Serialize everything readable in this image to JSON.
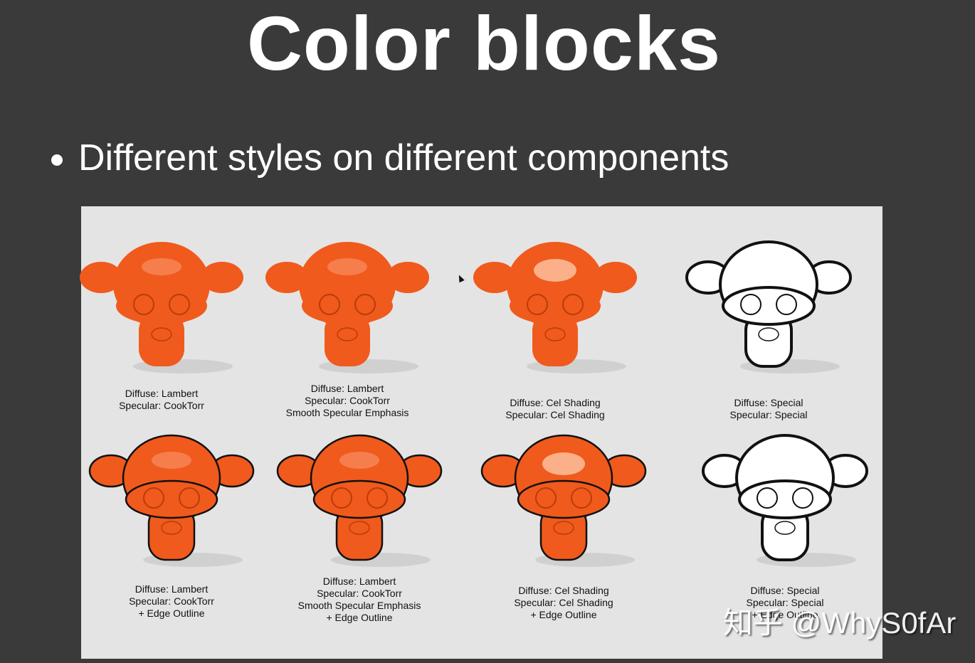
{
  "slide": {
    "title": "Color blocks",
    "bullet": "Different styles on different components"
  },
  "figure": {
    "colors": {
      "orange": "#f05a1c",
      "background": "#e4e4e4",
      "outline": "#111111",
      "white": "#ffffff"
    },
    "cells": [
      {
        "style": "orange",
        "outline": false,
        "caption": [
          "Diffuse: Lambert",
          "Specular: CookTorr"
        ]
      },
      {
        "style": "orange",
        "outline": false,
        "caption": [
          "Diffuse: Lambert",
          "Specular: CookTorr",
          "Smooth Specular Emphasis"
        ]
      },
      {
        "style": "orange-cel",
        "outline": false,
        "caption": [
          "Diffuse: Cel Shading",
          "Specular: Cel Shading"
        ]
      },
      {
        "style": "white",
        "outline": true,
        "caption": [
          "Diffuse: Special",
          "Specular: Special"
        ]
      },
      {
        "style": "orange",
        "outline": true,
        "caption": [
          "Diffuse: Lambert",
          "Specular: CookTorr",
          "+ Edge Outline"
        ]
      },
      {
        "style": "orange",
        "outline": true,
        "caption": [
          "Diffuse: Lambert",
          "Specular: CookTorr",
          "Smooth Specular Emphasis",
          "+ Edge Outline"
        ]
      },
      {
        "style": "orange-cel",
        "outline": true,
        "caption": [
          "Diffuse: Cel Shading",
          "Specular: Cel Shading",
          "+ Edge Outline"
        ]
      },
      {
        "style": "white",
        "outline": true,
        "caption": [
          "Diffuse: Special",
          "Specular: Special",
          "+ Edge Outline"
        ]
      }
    ]
  },
  "watermark": "知乎 @WhyS0fAr"
}
